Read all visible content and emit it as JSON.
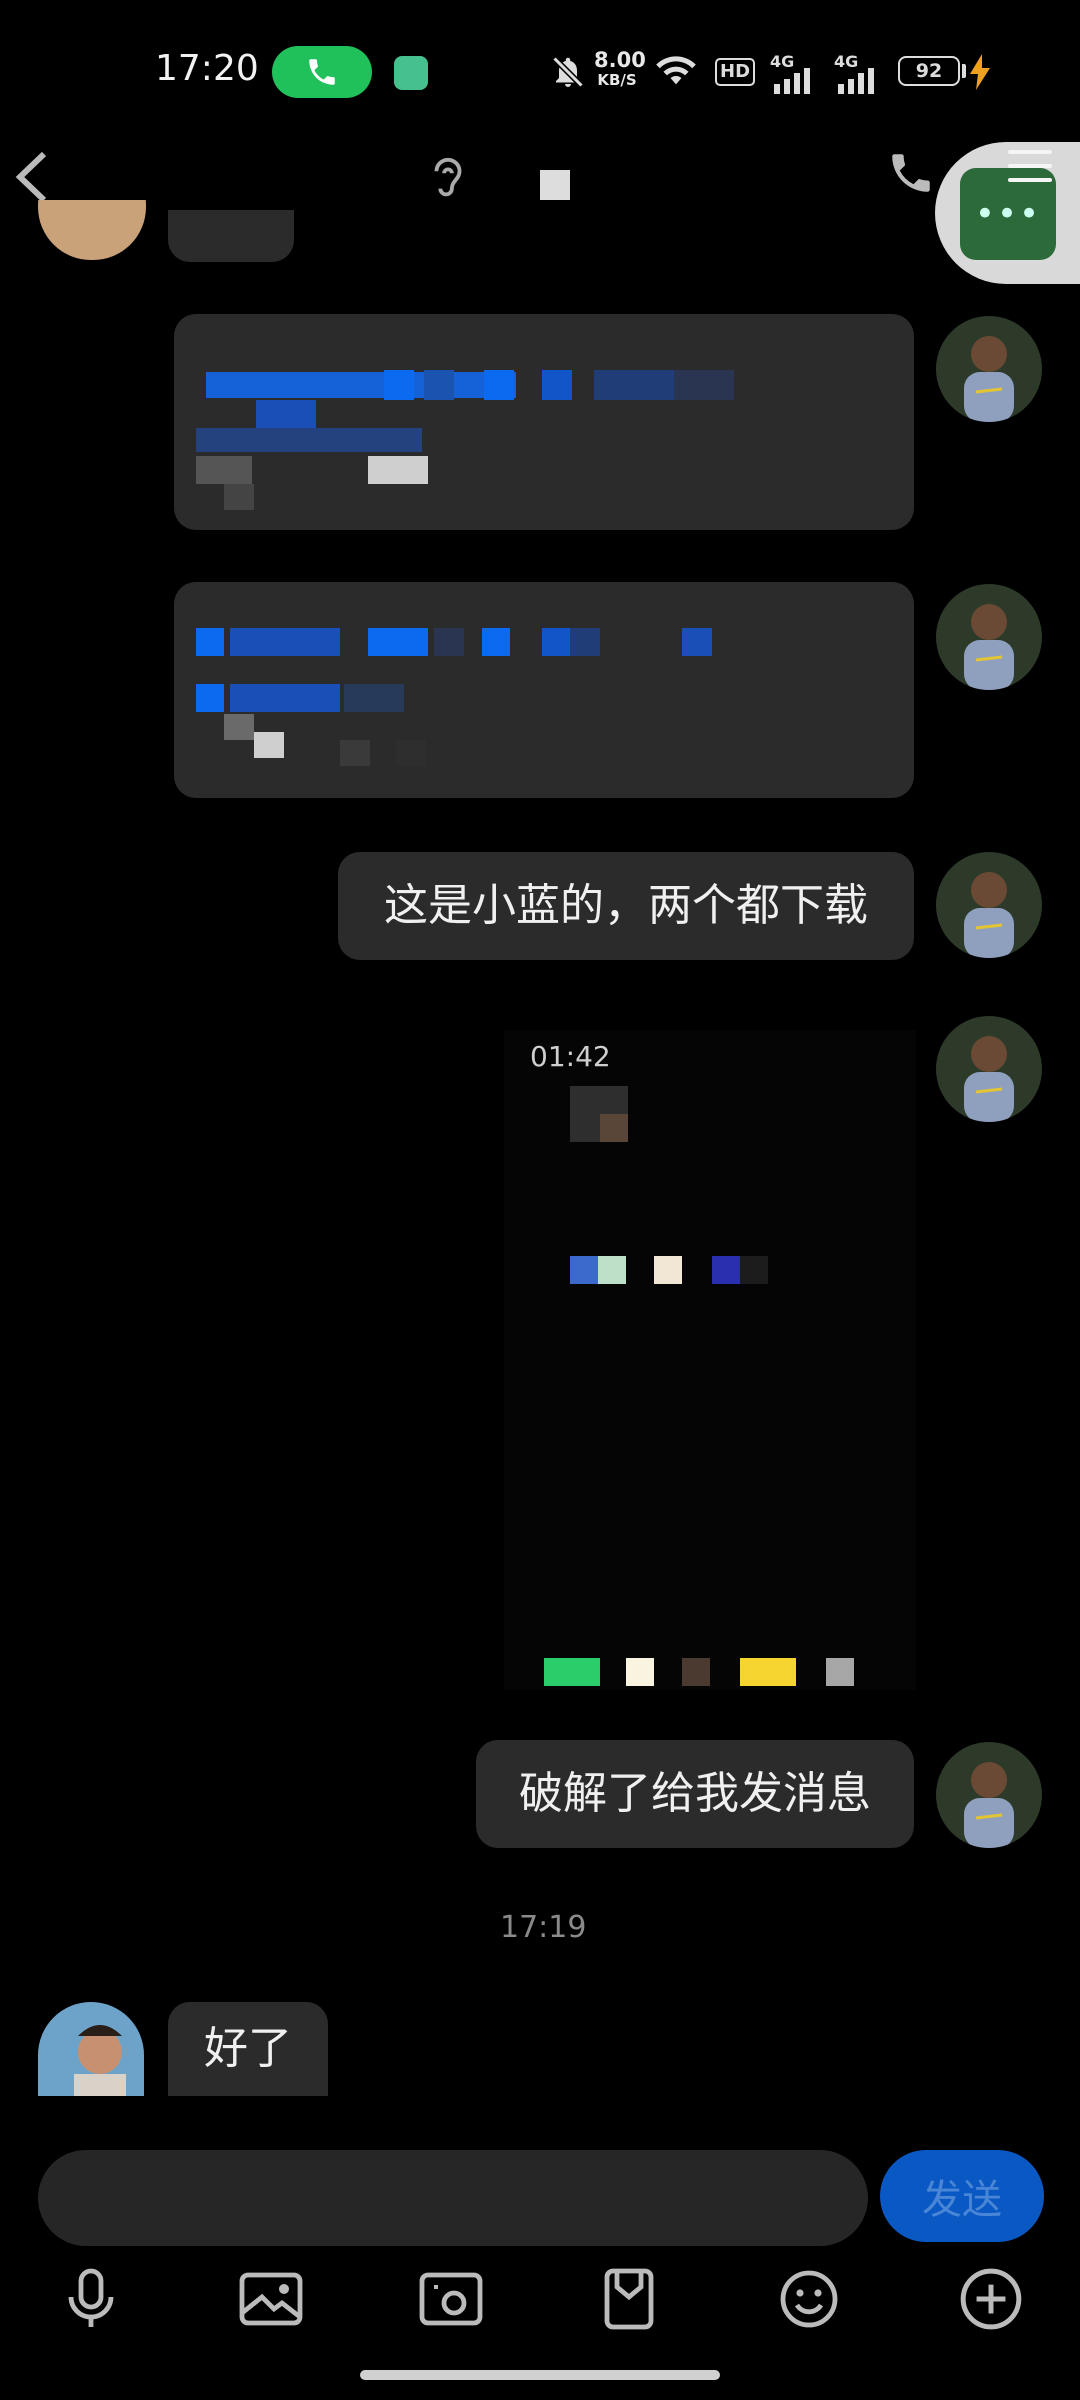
{
  "status_bar": {
    "time": "17:20",
    "net_speed_value": "8.00",
    "net_speed_unit": "KB/S",
    "hd_label": "HD",
    "network_1": "4G",
    "network_2": "4G",
    "battery": "92"
  },
  "chat": {
    "messages": [
      {
        "text": "这是小蓝的，两个都下载"
      },
      {
        "text": "破解了给我发消息"
      }
    ],
    "video_duration": "01:42",
    "timestamp": "17:19",
    "incoming": [
      {
        "text": "好了"
      }
    ]
  },
  "input": {
    "send_label": "发送"
  },
  "icons": {
    "back": "chevron-left-icon",
    "ear": "ear-icon",
    "phone": "phone-icon",
    "more": "more-icon",
    "mic": "microphone-icon",
    "gallery": "gallery-icon",
    "camera": "camera-icon",
    "clip": "bookmark-clip-icon",
    "emoji": "emoji-icon",
    "add": "plus-circle-icon"
  },
  "colors": {
    "background": "#000000",
    "bubble": "#2b2b2b",
    "send_button": "#0a58c4",
    "call_pill": "#20c05a"
  }
}
